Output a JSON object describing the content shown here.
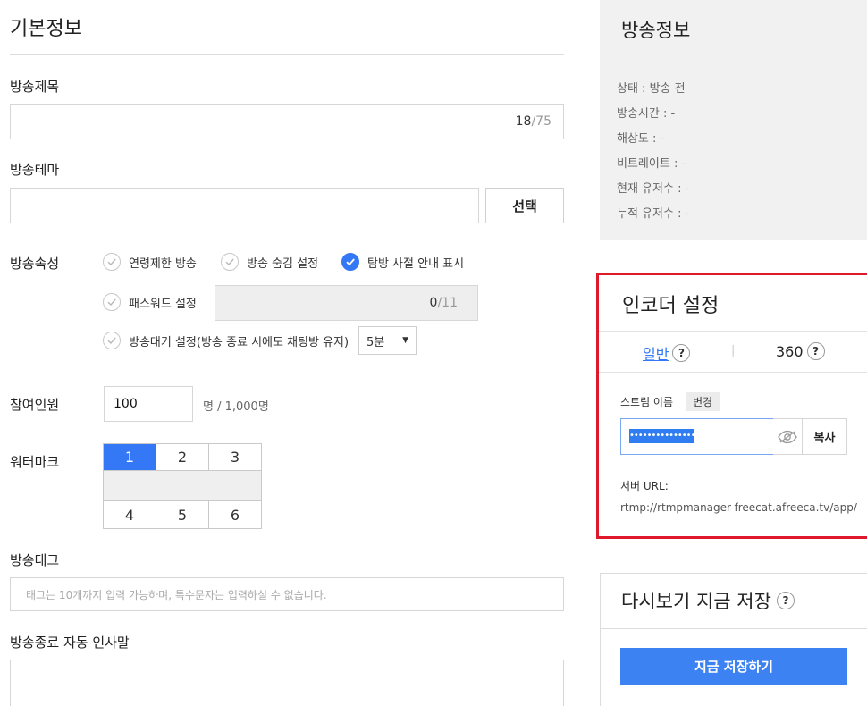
{
  "basic": {
    "title": "기본정보",
    "broadcast_title": {
      "label": "방송제목",
      "value": "",
      "count": "18",
      "max": "/75"
    },
    "theme": {
      "label": "방송테마",
      "value": "",
      "select_label": "선택"
    },
    "attributes": {
      "label": "방송속성",
      "age_limit": {
        "label": "연령제한 방송",
        "checked": false
      },
      "hide": {
        "label": "방송 숨김 설정",
        "checked": false
      },
      "tab_notice": {
        "label": "탐방 사절 안내 표시",
        "checked": true
      },
      "password": {
        "label": "패스워드 설정",
        "checked": false,
        "count": "0",
        "max": "/11"
      },
      "standby": {
        "label": "방송대기 설정(방송 종료 시에도 채팅방 유지)",
        "checked": false,
        "selected": "5분"
      }
    },
    "participants": {
      "label": "참여인원",
      "value": "100",
      "suffix": "명 / 1,000명"
    },
    "watermark": {
      "label": "워터마크",
      "top": [
        "1",
        "2",
        "3"
      ],
      "bottom": [
        "4",
        "5",
        "6"
      ],
      "selected": "1"
    },
    "tags": {
      "label": "방송태그",
      "placeholder": "태그는 10개까지 입력 가능하며, 특수문자는 입력하실 수 없습니다."
    },
    "greeting": {
      "label": "방송종료 자동 인사말",
      "value": ""
    }
  },
  "info": {
    "title": "방송정보",
    "rows": [
      {
        "label": "상태",
        "value": "방송 전"
      },
      {
        "label": "방송시간",
        "value": "-"
      },
      {
        "label": "해상도",
        "value": "-"
      },
      {
        "label": "비트레이트",
        "value": "-"
      },
      {
        "label": "현재 유저수",
        "value": "-"
      },
      {
        "label": "누적 유저수",
        "value": "-"
      }
    ]
  },
  "encoder": {
    "title": "인코더 설정",
    "tabs": [
      {
        "label": "일반",
        "active": true
      },
      {
        "label": "360",
        "active": false
      }
    ],
    "tab_divider": "|",
    "help": "?",
    "stream_label": "스트림 이름",
    "change_label": "변경",
    "stream_masked": "••••••••••••••••••••",
    "copy_label": "복사",
    "server_label": "서버 URL:",
    "server_url": "rtmp://rtmpmanager-freecat.afreeca.tv/app/"
  },
  "replay": {
    "title": "다시보기 지금 저장",
    "help": "?",
    "button": "지금 저장하기"
  },
  "colors": {
    "accent": "#3478f6",
    "highlight_border": "#e0182b"
  }
}
